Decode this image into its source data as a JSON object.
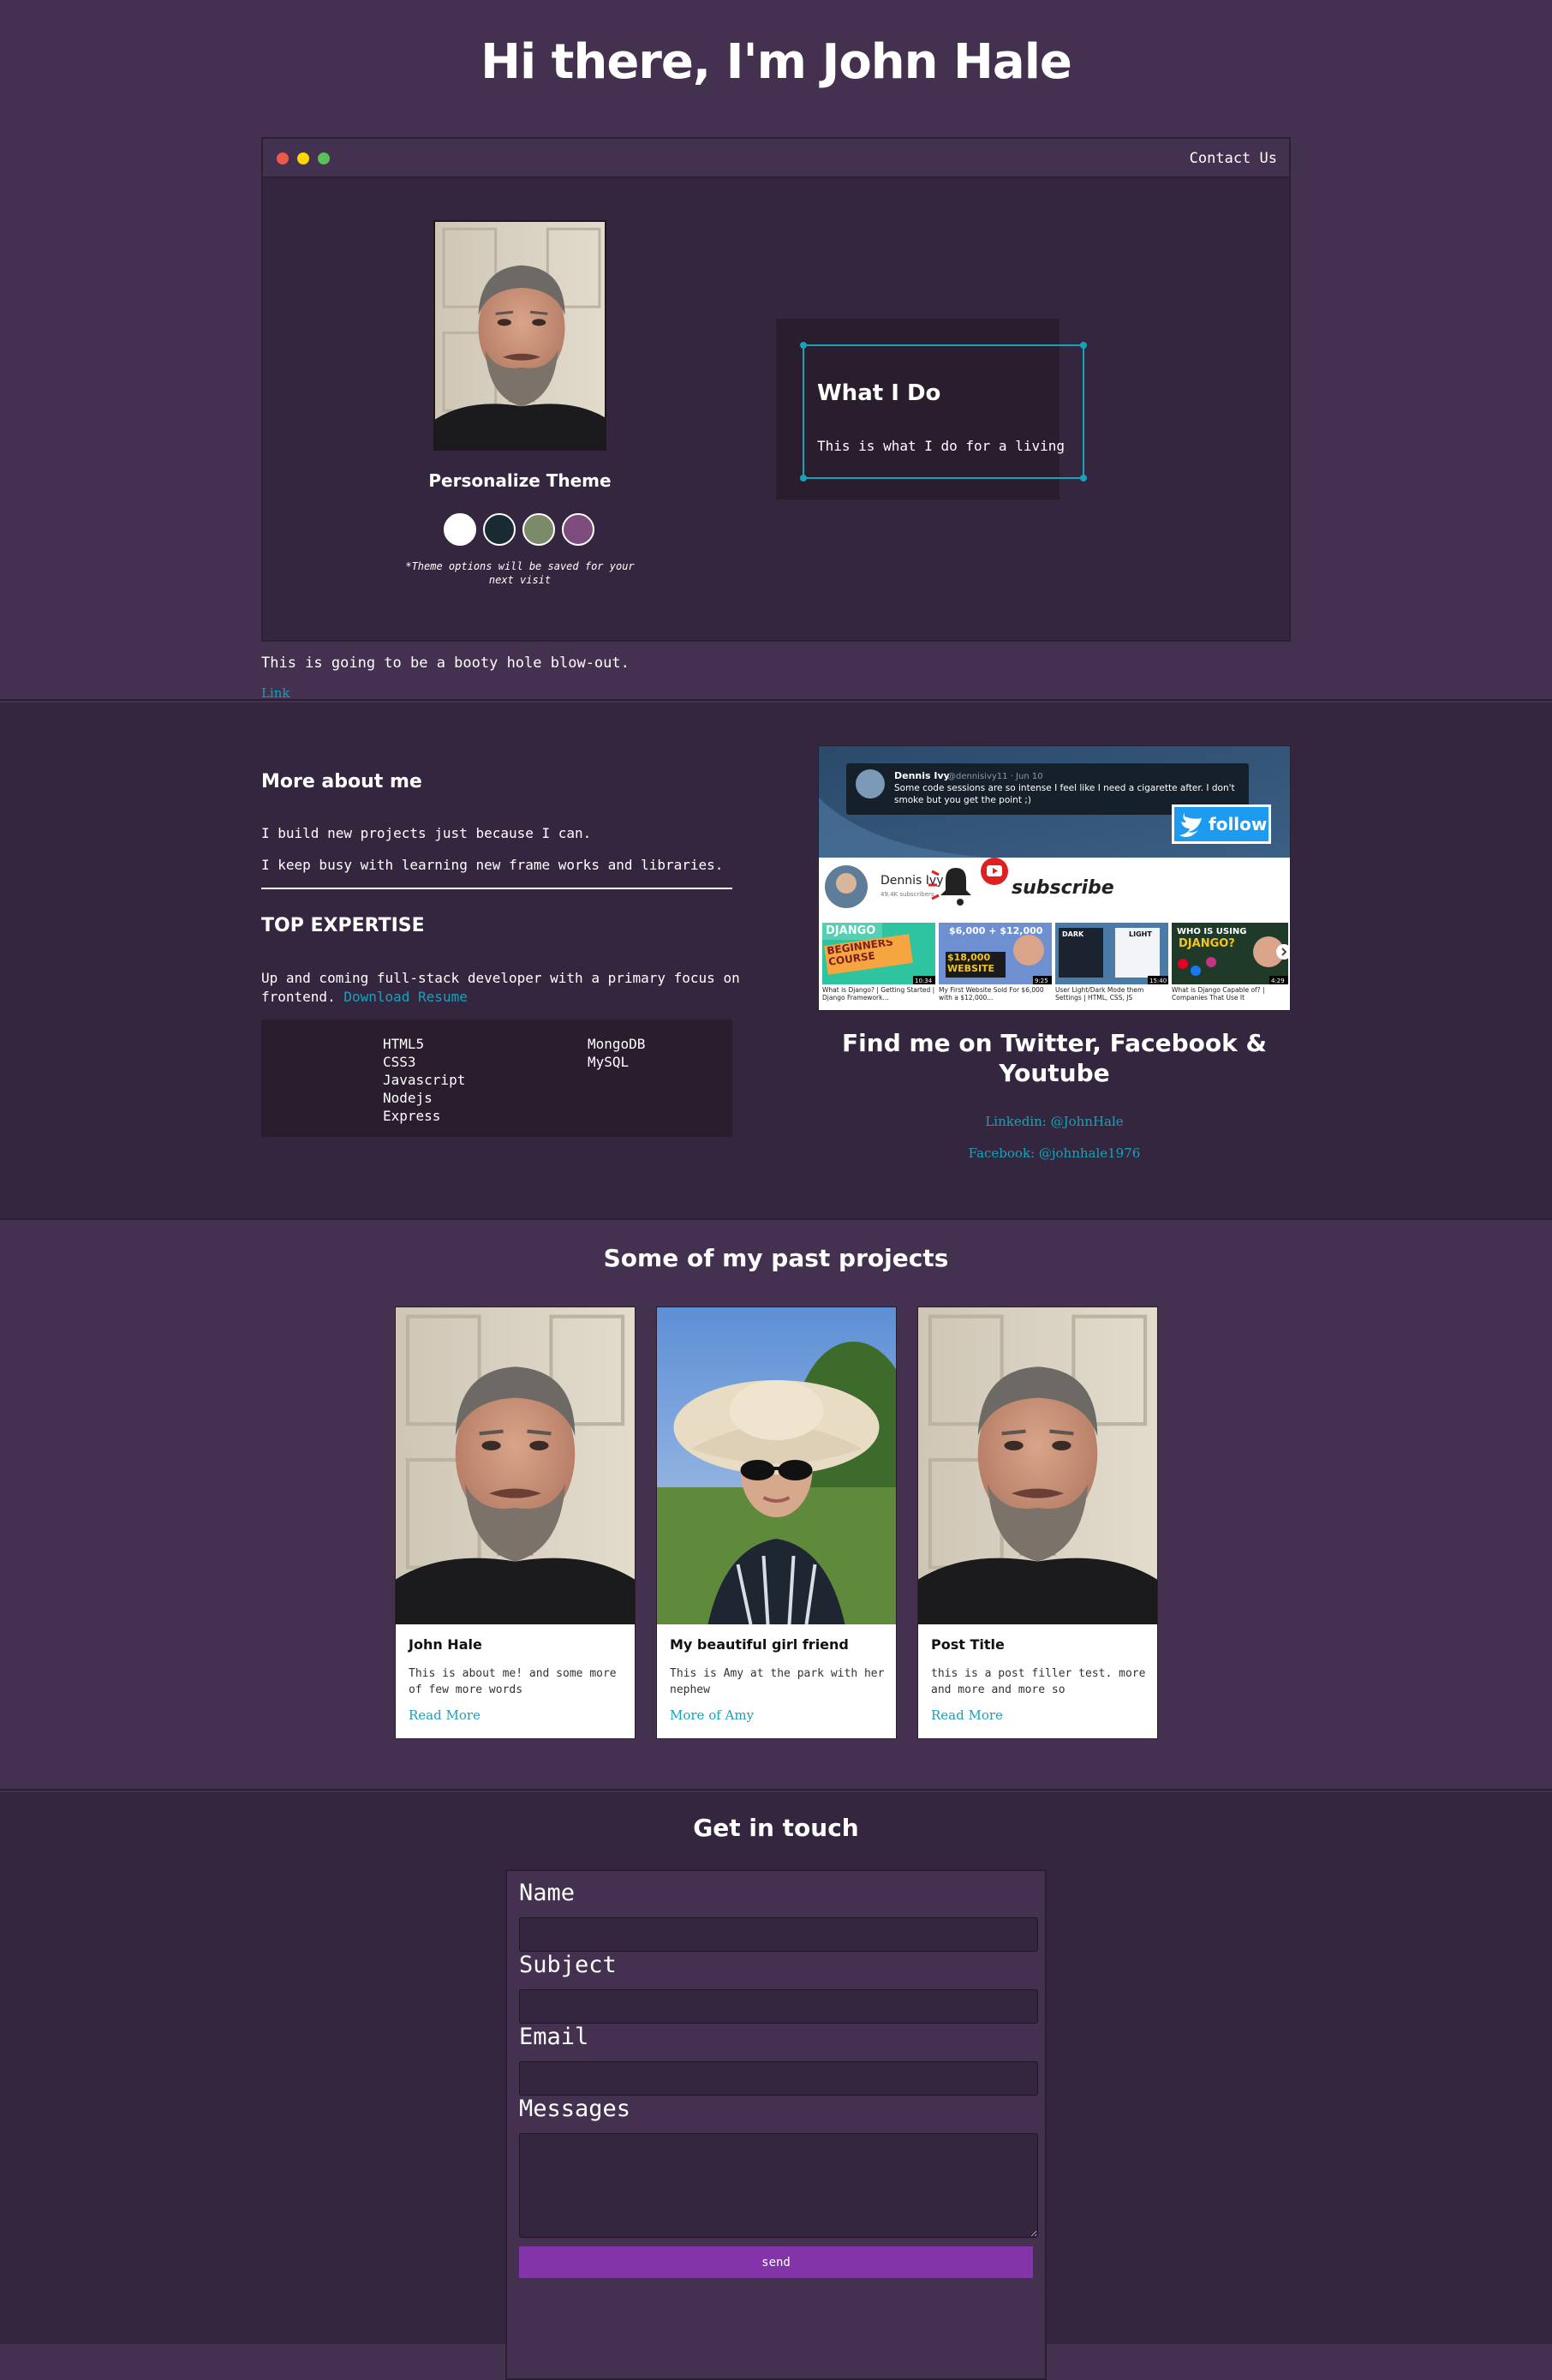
{
  "header": {
    "title": "Hi there, I'm John Hale"
  },
  "window": {
    "contact_label": "Contact Us",
    "theme_title": "Personalize Theme",
    "theme_note": "*Theme options will be saved for your next visit",
    "themes": [
      {
        "name": "light",
        "color": "#ffffff"
      },
      {
        "name": "blue",
        "color": "#192a32"
      },
      {
        "name": "green",
        "color": "#7b8b69"
      },
      {
        "name": "purple",
        "color": "#7e4c7c"
      }
    ],
    "what_title": "What I Do",
    "what_text": "This is what I do for a living"
  },
  "intro": {
    "text": "This is going to be a booty hole blow-out.",
    "link_label": "Link"
  },
  "about": {
    "title": "More about me",
    "lines": [
      "I build new projects just because I can.",
      "I keep busy with learning new frame works and libraries."
    ],
    "expertise_title": "TOP EXPERTISE",
    "expertise_text": "Up and coming full-stack developer with a primary focus on frontend.",
    "resume_label": "Download Resume",
    "skills_col1": [
      "HTML5",
      "CSS3",
      "Javascript",
      "Nodejs",
      "Express"
    ],
    "skills_col2": [
      "MongoDB",
      "MySQL"
    ]
  },
  "social": {
    "image": {
      "tweet_name": "Dennis Ivy",
      "tweet_handle": "@dennisivy11 · Jun 10",
      "tweet_text": "Some code sessions are so intense I feel like I need a cigarette after. I don't smoke but you get the point ;)",
      "follow_label": "follow",
      "channel_name": "Dennis Ivy",
      "channel_subs": "49.4K subscribers",
      "subscribe_label": "subscribe",
      "thumbs": [
        {
          "top": "DJANGO",
          "mid": "BEGINNERS COURSE",
          "time": "10:34",
          "caption": "What is Django? | Getting Started | Django Framework..."
        },
        {
          "top": "$6,000 + $12,000",
          "mid": "$18,000 WEBSITE",
          "time": "9:25",
          "caption": "My First Website Sold For $6,000 with a $12,000..."
        },
        {
          "top": "DARK",
          "mid": "LIGHT",
          "time": "15:40",
          "caption": "User Light/Dark Mode them Settings | HTML, CSS, JS"
        },
        {
          "top": "WHO IS USING",
          "mid": "DJANGO?",
          "time": "4:29",
          "caption": "What is Django Capable of? | Companies That Use It"
        }
      ]
    },
    "title": "Find me on Twitter, Facebook & Youtube",
    "linkedin": "Linkedin: @JohnHale",
    "facebook": "Facebook: @johnhale1976"
  },
  "projects": {
    "title": "Some of my past projects",
    "cards": [
      {
        "title": "John Hale",
        "text": "This is about me! and some more of few more words",
        "link": "Read More"
      },
      {
        "title": "My beautiful girl friend",
        "text": "This is Amy at the park with her nephew",
        "link": "More of Amy"
      },
      {
        "title": "Post Title",
        "text": "this is a post filler test. more and more and more so",
        "link": "Read More"
      }
    ]
  },
  "contact": {
    "title": "Get in touch",
    "name_label": "Name",
    "subject_label": "Subject",
    "email_label": "Email",
    "messages_label": "Messages",
    "name_value": "",
    "subject_value": "",
    "email_value": "",
    "messages_value": "",
    "send_label": "send"
  }
}
